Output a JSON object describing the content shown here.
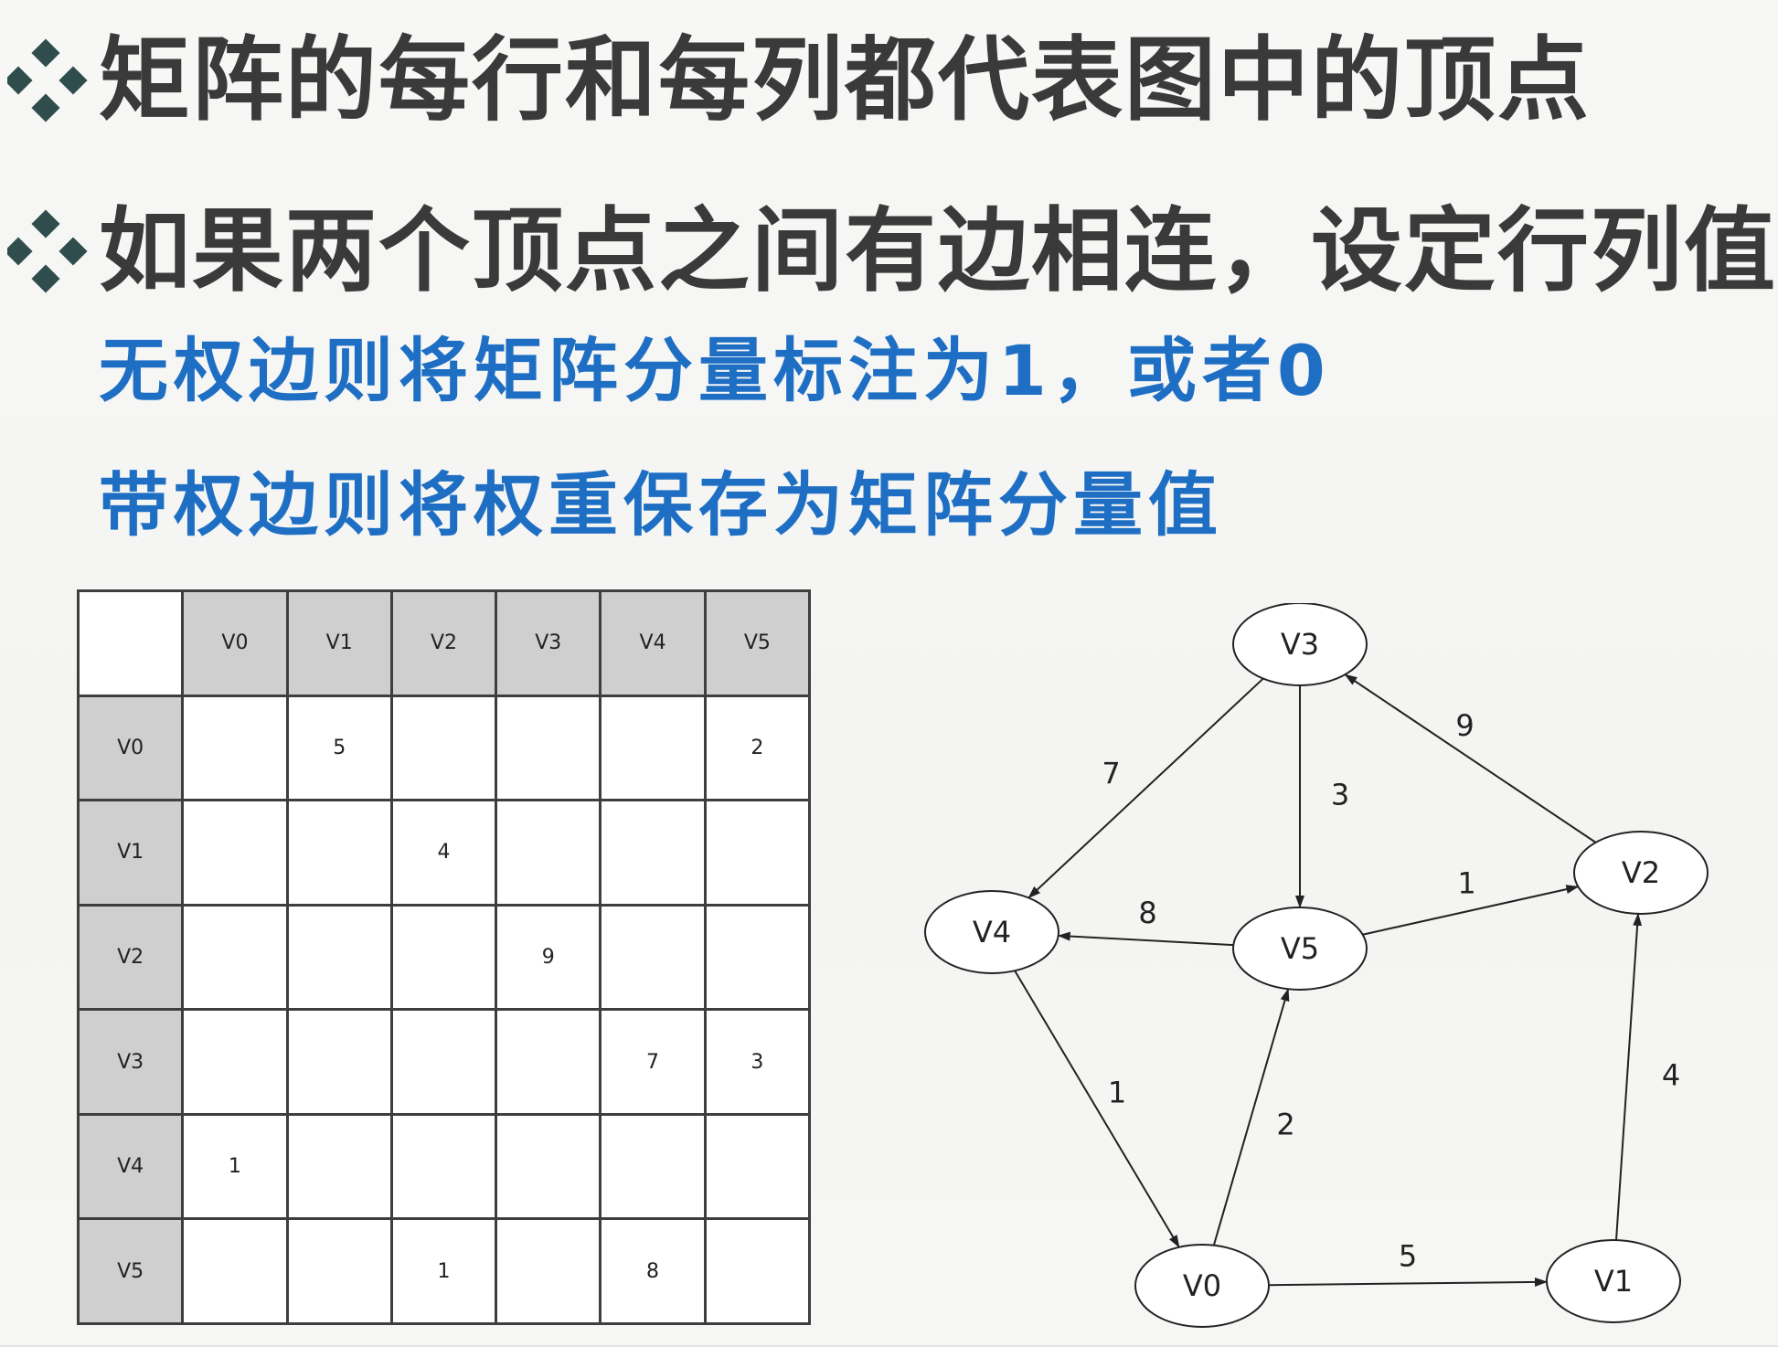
{
  "bullets": [
    "矩阵的每行和每列都代表图中的顶点",
    "如果两个顶点之间有边相连，设定行列值"
  ],
  "subpoints": [
    "无权边则将矩阵分量标注为1，或者0",
    "带权边则将权重保存为矩阵分量值"
  ],
  "colors": {
    "heading": "#3a3a3a",
    "subtext": "#1e6fc4",
    "bullet_icon": "#2f4d4d",
    "header_cell": "#cfcfcf"
  },
  "matrix": {
    "columns": [
      "V0",
      "V1",
      "V2",
      "V3",
      "V4",
      "V5"
    ],
    "rows": [
      {
        "label": "V0",
        "cells": [
          "",
          "5",
          "",
          "",
          "",
          "2"
        ]
      },
      {
        "label": "V1",
        "cells": [
          "",
          "",
          "4",
          "",
          "",
          ""
        ]
      },
      {
        "label": "V2",
        "cells": [
          "",
          "",
          "",
          "9",
          "",
          ""
        ]
      },
      {
        "label": "V3",
        "cells": [
          "",
          "",
          "",
          "",
          "7",
          "3"
        ]
      },
      {
        "label": "V4",
        "cells": [
          "1",
          "",
          "",
          "",
          "",
          ""
        ]
      },
      {
        "label": "V5",
        "cells": [
          "",
          "",
          "1",
          "",
          "8",
          ""
        ]
      }
    ]
  },
  "graph": {
    "nodes": [
      "V0",
      "V1",
      "V2",
      "V3",
      "V4",
      "V5"
    ],
    "edges": [
      {
        "from": "V0",
        "to": "V1",
        "weight": "5"
      },
      {
        "from": "V0",
        "to": "V5",
        "weight": "2"
      },
      {
        "from": "V1",
        "to": "V2",
        "weight": "4"
      },
      {
        "from": "V2",
        "to": "V3",
        "weight": "9"
      },
      {
        "from": "V3",
        "to": "V4",
        "weight": "7"
      },
      {
        "from": "V3",
        "to": "V5",
        "weight": "3"
      },
      {
        "from": "V4",
        "to": "V0",
        "weight": "1"
      },
      {
        "from": "V5",
        "to": "V2",
        "weight": "1"
      },
      {
        "from": "V5",
        "to": "V4",
        "weight": "8"
      }
    ]
  }
}
